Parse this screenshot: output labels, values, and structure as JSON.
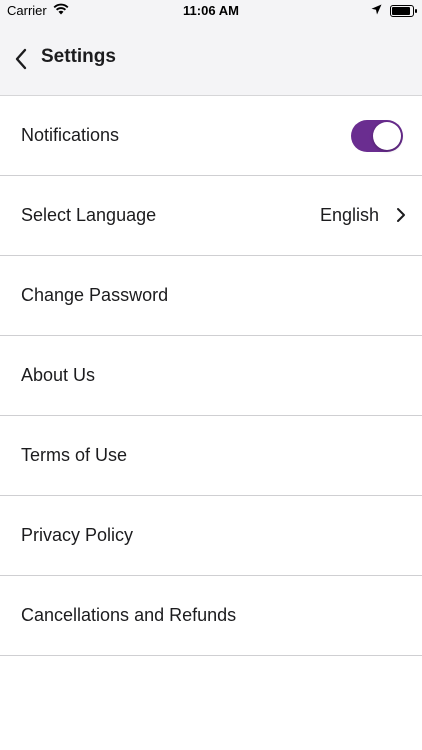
{
  "status_bar": {
    "carrier": "Carrier",
    "time": "11:06 AM",
    "icons": [
      "wifi-icon",
      "location-icon",
      "battery-icon"
    ]
  },
  "header": {
    "title": "Settings",
    "back_icon": "chevron-left-icon"
  },
  "colors": {
    "accent": "#6a2d90",
    "header_bg": "#f4f4f6",
    "divider": "#cfcfd2"
  },
  "settings": {
    "notifications": {
      "label": "Notifications",
      "enabled": true
    },
    "language": {
      "label": "Select Language",
      "value": "English"
    },
    "change_password": {
      "label": "Change Password"
    },
    "about_us": {
      "label": "About Us"
    },
    "terms": {
      "label": "Terms of Use"
    },
    "privacy": {
      "label": "Privacy Policy"
    },
    "cancellations": {
      "label": "Cancellations and Refunds"
    }
  }
}
